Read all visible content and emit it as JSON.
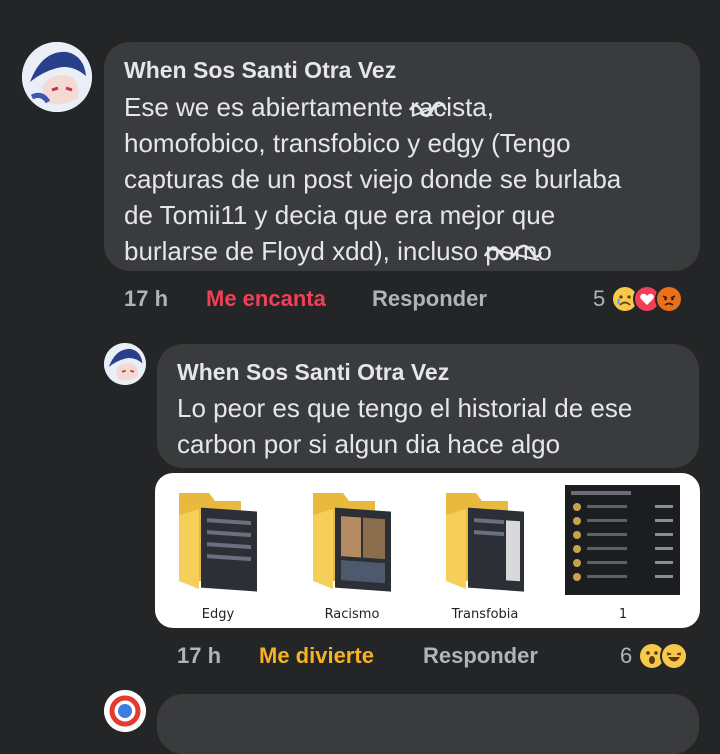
{
  "comment1": {
    "author": "When Sos Santi Otra Vez",
    "lines": [
      "Ese we es abiertamente",
      "sta,",
      "homofobico, transfobico y edgy (Tengo",
      "capturas de un post viejo donde se burlaba",
      "de Tomii11 y decia que era mejor que",
      "burlarse de Floyd xdd), incluso"
    ],
    "time": "17 h",
    "reaction_label": "Me encanta",
    "reply_label": "Responder",
    "reaction_count": "5",
    "reaction_icons": [
      "sad-emoji-icon",
      "heart-icon",
      "angry-emoji-icon"
    ],
    "colors": {
      "reaction": "#f33e58"
    }
  },
  "comment2": {
    "author": "When Sos Santi Otra Vez",
    "lines": [
      "Lo peor es que tengo el historial de ese",
      "carbon por si algun dia hace algo"
    ],
    "attachments": [
      {
        "label": "Edgy",
        "icon": "folder-icon"
      },
      {
        "label": "Racismo",
        "icon": "folder-icon"
      },
      {
        "label": "Transfobia",
        "icon": "folder-icon"
      },
      {
        "label": "1",
        "icon": "screenshot-thumbnail"
      }
    ],
    "time": "17 h",
    "reaction_label": "Me divierte",
    "reply_label": "Responder",
    "reaction_count": "6",
    "reaction_icons": [
      "wow-emoji-icon",
      "haha-emoji-icon"
    ],
    "colors": {
      "reaction": "#f7b125"
    }
  }
}
